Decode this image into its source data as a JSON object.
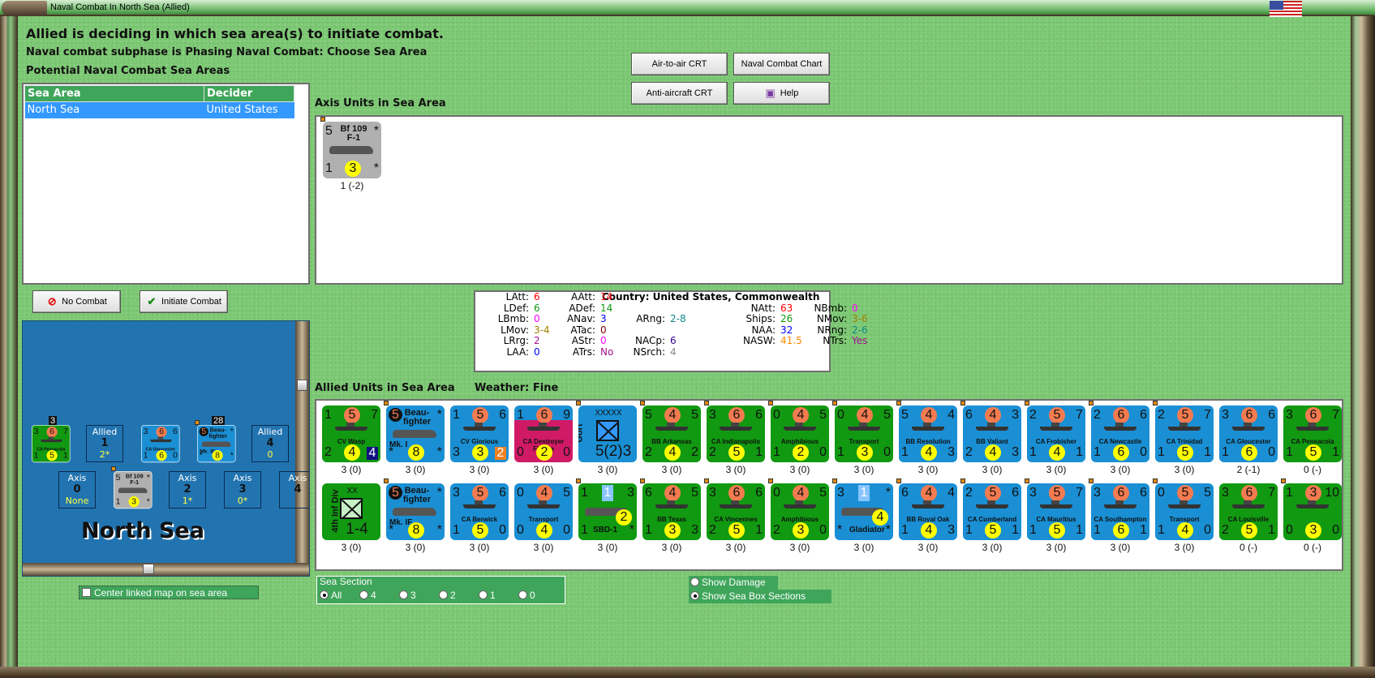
{
  "window": {
    "title": "Naval Combat In North Sea (Allied)"
  },
  "header": {
    "status": "Allied is deciding in which sea area(s) to initiate combat.",
    "subphase": "Naval combat subphase is Phasing Naval Combat: Choose Sea Area",
    "list_title": "Potential Naval Combat Sea Areas"
  },
  "sea_table": {
    "columns": [
      "Sea Area",
      "Decider"
    ],
    "rows": [
      [
        "North Sea",
        "United States"
      ]
    ]
  },
  "buttons": {
    "air_to_air": "Air-to-air CRT",
    "naval_chart": "Naval Combat Chart",
    "anti_aircraft": "Anti-aircraft CRT",
    "help": "Help",
    "no_combat": "No Combat",
    "initiate": "Initiate Combat"
  },
  "axis": {
    "title": "Axis Units in Sea Area",
    "units": [
      {
        "kind": "air",
        "color": "gray",
        "tl": "5",
        "tr": "*",
        "name": "Bf 109 F-1",
        "bl": "1",
        "bc": "3",
        "br": "*",
        "label": "1 (-2)",
        "dot": true
      }
    ]
  },
  "stats": {
    "country": "Country: United States, Commonwealth",
    "items": [
      {
        "k": "LAtt:",
        "v": "6",
        "c": "#ff0000"
      },
      {
        "k": "LDef:",
        "v": "6",
        "c": "#119911"
      },
      {
        "k": "LBmb:",
        "v": "0",
        "c": "#ff00ff"
      },
      {
        "k": "LMov:",
        "v": "3-4",
        "c": "#a08000"
      },
      {
        "k": "LRrg:",
        "v": "2",
        "c": "#a01090"
      },
      {
        "k": "LAA:",
        "v": "0",
        "c": "#0000ff"
      },
      {
        "k": "AAtt:",
        "v": "14",
        "c": "#ff0000"
      },
      {
        "k": "ADef:",
        "v": "14",
        "c": "#119911"
      },
      {
        "k": "ANav:",
        "v": "3",
        "c": "#0000ff"
      },
      {
        "k": "ATac:",
        "v": "0",
        "c": "#800000"
      },
      {
        "k": "AStr:",
        "v": "0",
        "c": "#ff00ff"
      },
      {
        "k": "ATrs:",
        "v": "No",
        "c": "#a01090"
      },
      {
        "k": "ARng:",
        "v": "2-8",
        "c": "#108888"
      },
      {
        "k": "NACp:",
        "v": "6",
        "c": "#300090"
      },
      {
        "k": "NSrch:",
        "v": "4",
        "c": "#888888"
      },
      {
        "k": "NAtt:",
        "v": "63",
        "c": "#ff0000"
      },
      {
        "k": "Ships:",
        "v": "26",
        "c": "#119911"
      },
      {
        "k": "NAA:",
        "v": "32",
        "c": "#0000ff"
      },
      {
        "k": "NASW:",
        "v": "41.5",
        "c": "#ff8800"
      },
      {
        "k": "NBmb:",
        "v": "0",
        "c": "#ff00ff"
      },
      {
        "k": "NMov:",
        "v": "3-6",
        "c": "#a08000"
      },
      {
        "k": "NRng:",
        "v": "2-6",
        "c": "#108888"
      },
      {
        "k": "NTrs:",
        "v": "Yes",
        "c": "#a01090"
      }
    ]
  },
  "allied": {
    "title": "Allied Units in Sea Area",
    "weather": "Weather:  Fine",
    "rows": [
      [
        {
          "kind": "ship",
          "color": "green",
          "tl": "1",
          "tc": "5",
          "tr": "7",
          "name": "CV Wasp",
          "bl": "2",
          "bc": "4",
          "badge": "4",
          "badge_color": "#101080",
          "label": "3 (0)"
        },
        {
          "kind": "air",
          "color": "blue",
          "blk": "5",
          "name": "Beau-fighter",
          "sub": "Mk. I",
          "tr": "*",
          "bl": "*",
          "bc": "8",
          "br": "*",
          "label": "3 (0)",
          "dot": true
        },
        {
          "kind": "ship",
          "color": "blue",
          "tl": "1",
          "tc": "5",
          "tr": "6",
          "name": "CV Glorious",
          "bl": "3",
          "bc": "3",
          "badge": "2",
          "badge_color": "#f08020",
          "label": "3 (0)"
        },
        {
          "kind": "ship",
          "color": "pink",
          "tl": "1",
          "tc": "6",
          "tr": "9",
          "name": "CA Destroyer Flotilla",
          "bl": "0",
          "bc": "2",
          "br": "0",
          "label": "3 (0)"
        },
        {
          "kind": "land",
          "color": "blue",
          "vert": "Gort",
          "size": "XXXXX",
          "str": "5(2)3",
          "label": "3 (0)",
          "dot": true
        },
        {
          "kind": "ship",
          "color": "green",
          "tl": "5",
          "tc": "4",
          "tr": "5",
          "name": "BB Arkansas",
          "bl": "2",
          "bc": "4",
          "br": "2",
          "label": "3 (0)",
          "dot": true
        },
        {
          "kind": "ship",
          "color": "green",
          "tl": "3",
          "tc": "6",
          "tr": "6",
          "name": "CA Indianapolis",
          "bl": "2",
          "bc": "5",
          "br": "1",
          "label": "3 (0)",
          "dot": true
        },
        {
          "kind": "ship",
          "color": "green",
          "tl": "0",
          "tc": "4",
          "tr": "5",
          "name": "Amphibious",
          "bl": "1",
          "bc": "2",
          "br": "0",
          "label": "3 (0)",
          "dot": true
        },
        {
          "kind": "ship",
          "color": "green",
          "tl": "0",
          "tc": "4",
          "tr": "5",
          "name": "Transport",
          "bl": "1",
          "bc": "3",
          "br": "0",
          "label": "3 (0)",
          "dot": true
        },
        {
          "kind": "ship",
          "color": "blue",
          "tl": "5",
          "tc": "4",
          "tr": "4",
          "name": "BB Resolution",
          "bl": "1",
          "bc": "4",
          "br": "3",
          "label": "3 (0)",
          "dot": true
        },
        {
          "kind": "ship",
          "color": "blue",
          "tl": "6",
          "tc": "4",
          "tr": "3",
          "name": "BB Valiant",
          "bl": "2",
          "bc": "4",
          "br": "3",
          "label": "3 (0)",
          "dot": true
        },
        {
          "kind": "ship",
          "color": "blue",
          "tl": "2",
          "tc": "5",
          "tr": "7",
          "name": "CA Frobisher",
          "bl": "1",
          "bc": "4",
          "br": "1",
          "label": "3 (0)",
          "dot": true
        },
        {
          "kind": "ship",
          "color": "blue",
          "tl": "2",
          "tc": "6",
          "tr": "6",
          "name": "CA Newcastle",
          "bl": "1",
          "bc": "6",
          "br": "0",
          "label": "3 (0)",
          "dot": true
        },
        {
          "kind": "ship",
          "color": "blue",
          "tl": "2",
          "tc": "5",
          "tr": "7",
          "name": "CA Trinidad",
          "bl": "1",
          "bc": "5",
          "br": "1",
          "label": "3 (0)",
          "dot": true
        },
        {
          "kind": "ship",
          "color": "blue",
          "tl": "3",
          "tc": "6",
          "tr": "6",
          "name": "CA Gloucester",
          "bl": "1",
          "bc": "6",
          "br": "0",
          "label": "2 (-1)"
        },
        {
          "kind": "ship",
          "color": "green",
          "tl": "3",
          "tc": "6",
          "tr": "7",
          "name": "CA Pensacola",
          "bl": "1",
          "bc": "5",
          "br": "1",
          "label": "0 (-)"
        }
      ],
      [
        {
          "kind": "land",
          "color": "green",
          "vert": "4th Inf Div",
          "size": "XX",
          "str": "1-4",
          "label": "3 (0)",
          "lightbox": true
        },
        {
          "kind": "air",
          "color": "blue",
          "blk": "5",
          "name": "Beau-fighter",
          "sub": "Mk. IF",
          "tr": "*",
          "bl": "*",
          "bc": "8",
          "br": "*",
          "label": "3 (0)",
          "dot": true
        },
        {
          "kind": "ship",
          "color": "blue",
          "tl": "3",
          "tc": "5",
          "tr": "6",
          "name": "CA Berwick",
          "bl": "1",
          "bc": "5",
          "br": "0",
          "label": "3 (0)"
        },
        {
          "kind": "ship",
          "color": "blue",
          "tl": "0",
          "tc": "4",
          "tr": "5",
          "name": "Transport",
          "bl": "0",
          "bc": "4",
          "br": "0",
          "label": "3 (0)"
        },
        {
          "kind": "air",
          "color": "green",
          "tl": "1",
          "tag": "1",
          "tr": "3",
          "sub": "SBD-1",
          "bl": "1",
          "mid": "2",
          "br": "*",
          "label": "3 (0)",
          "dot": true
        },
        {
          "kind": "ship",
          "color": "green",
          "tl": "6",
          "tc": "4",
          "tr": "5",
          "name": "BB Texas",
          "bl": "1",
          "bc": "3",
          "br": "3",
          "label": "3 (0)",
          "dot": true
        },
        {
          "kind": "ship",
          "color": "green",
          "tl": "3",
          "tc": "6",
          "tr": "6",
          "name": "CA Vincennes",
          "bl": "2",
          "bc": "5",
          "br": "1",
          "label": "3 (0)",
          "dot": true
        },
        {
          "kind": "ship",
          "color": "green",
          "tl": "0",
          "tc": "4",
          "tr": "5",
          "name": "Amphibious",
          "bl": "2",
          "bc": "3",
          "br": "0",
          "label": "3 (0)",
          "dot": true
        },
        {
          "kind": "air",
          "color": "blue",
          "tl": "3",
          "tag": "1",
          "tr": "*",
          "sub": "Gladiator",
          "bl": "*",
          "mid": "4",
          "br": "*",
          "label": "3 (0)",
          "dot": true
        },
        {
          "kind": "ship",
          "color": "blue",
          "tl": "6",
          "tc": "4",
          "tr": "4",
          "name": "BB Royal Oak",
          "bl": "1",
          "bc": "4",
          "br": "3",
          "label": "3 (0)",
          "dot": true
        },
        {
          "kind": "ship",
          "color": "blue",
          "tl": "2",
          "tc": "5",
          "tr": "6",
          "name": "CA Cumberland",
          "bl": "1",
          "bc": "5",
          "br": "1",
          "label": "3 (0)",
          "dot": true
        },
        {
          "kind": "ship",
          "color": "blue",
          "tl": "3",
          "tc": "5",
          "tr": "7",
          "name": "CA Mauritius",
          "bl": "1",
          "bc": "5",
          "br": "1",
          "label": "3 (0)",
          "dot": true
        },
        {
          "kind": "ship",
          "color": "blue",
          "tl": "3",
          "tc": "6",
          "tr": "6",
          "name": "CA Southampton",
          "bl": "1",
          "bc": "6",
          "br": "1",
          "label": "3 (0)",
          "dot": true
        },
        {
          "kind": "ship",
          "color": "blue",
          "tl": "0",
          "tc": "5",
          "tr": "5",
          "name": "Transport",
          "bl": "1",
          "bc": "4",
          "br": "0",
          "label": "3 (0)",
          "dot": true
        },
        {
          "kind": "ship",
          "color": "green",
          "tl": "3",
          "tc": "6",
          "tr": "7",
          "name": "CA Louisville",
          "bl": "2",
          "bc": "5",
          "br": "1",
          "label": "0 (-)"
        },
        {
          "kind": "ship",
          "color": "green",
          "tl": "1",
          "tc": "3",
          "tr": "10",
          "name": "",
          "bl": "0",
          "bc": "3",
          "br": "0",
          "label": "0 (-)",
          "dot": true
        }
      ]
    ]
  },
  "map": {
    "sea_name": "North Sea",
    "stack_counts": [
      "3",
      "28"
    ],
    "boxes": [
      {
        "side": "Allied",
        "num": "1",
        "val": "2*"
      },
      {
        "side": "Allied",
        "num": "4",
        "val": "0"
      },
      {
        "side": "Axis",
        "num": "0",
        "val": "None"
      },
      {
        "side": "Axis",
        "num": "2",
        "val": "1*"
      },
      {
        "side": "Axis",
        "num": "3",
        "val": "0*"
      },
      {
        "side": "Axis",
        "num": "4",
        "val": ""
      }
    ],
    "counters": [
      {
        "kind": "ship",
        "color": "green",
        "tl": "3",
        "tc": "6",
        "tr": "7",
        "name": "CA Pensacola",
        "bl": "1",
        "bc": "5",
        "br": "1"
      },
      {
        "kind": "ship",
        "color": "blue",
        "tl": "3",
        "tc": "6",
        "tr": "6",
        "name": "CA Gloucester",
        "bl": "1",
        "bc": "6",
        "br": "0"
      },
      {
        "kind": "air",
        "color": "blue",
        "blk": "5",
        "name": "Beau-fighter",
        "sub": "Mk. IF",
        "tr": "*",
        "bl": "*",
        "bc": "8",
        "br": "*",
        "dot": true
      },
      {
        "kind": "air",
        "color": "gray",
        "tl": "5",
        "tr": "*",
        "name": "Bf 109 F-1",
        "bl": "1",
        "bc": "3",
        "br": "*",
        "dot": true
      }
    ]
  },
  "options": {
    "center_map": "Center linked map on sea area",
    "sea_section": "Sea Section",
    "sections": [
      "All",
      "4",
      "3",
      "2",
      "1",
      "0"
    ],
    "selected_section": "All",
    "show_damage": "Show Damage",
    "show_boxes": "Show Sea Box Sections",
    "selected_view": "Show Sea Box Sections"
  },
  "colors": {
    "panel_green": "#3fa55a",
    "selection": "#3399ff",
    "ship_green": "#119911",
    "ship_blue": "#1a8fd4"
  }
}
